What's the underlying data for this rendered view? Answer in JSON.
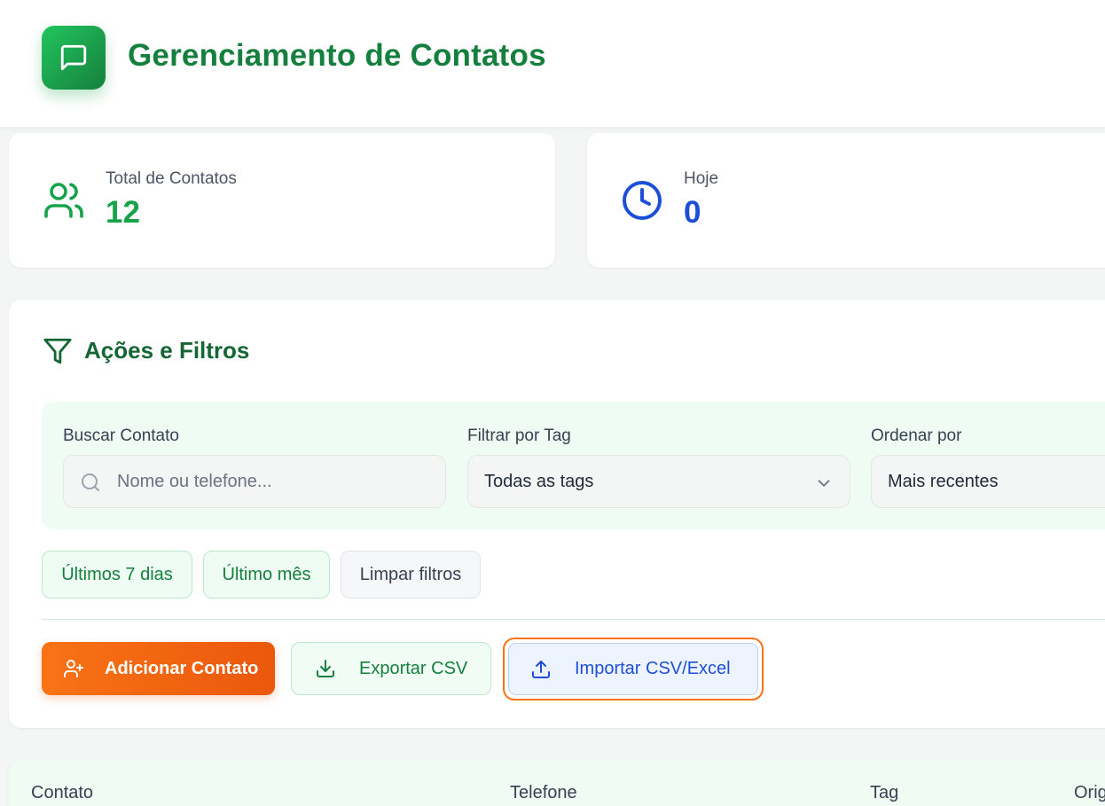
{
  "header": {
    "title": "Gerenciamento de Contatos",
    "logo_icon": "message-square-icon",
    "brand_color": "#15803d"
  },
  "stats": {
    "total": {
      "label": "Total de Contatos",
      "value": "12",
      "icon": "users-icon",
      "color": "#16a34a"
    },
    "today": {
      "label": "Hoje",
      "value": "0",
      "icon": "clock-icon",
      "color": "#1d4ed8"
    }
  },
  "actions_panel": {
    "title": "Ações e Filtros",
    "icon": "filter-icon",
    "search": {
      "label": "Buscar Contato",
      "placeholder": "Nome ou telefone...",
      "value": ""
    },
    "tag_filter": {
      "label": "Filtrar por Tag",
      "value": "Todas as tags"
    },
    "sort": {
      "label": "Ordenar por",
      "value": "Mais recentes"
    },
    "quick_filters": [
      "Últimos 7 dias",
      "Último mês",
      "Limpar filtros"
    ],
    "buttons": {
      "add": "Adicionar Contato",
      "export": "Exportar CSV",
      "import": "Importar CSV/Excel"
    },
    "accent_color": "#f97316"
  },
  "table": {
    "columns": [
      "Contato",
      "Telefone",
      "Tag",
      "Orig"
    ]
  }
}
